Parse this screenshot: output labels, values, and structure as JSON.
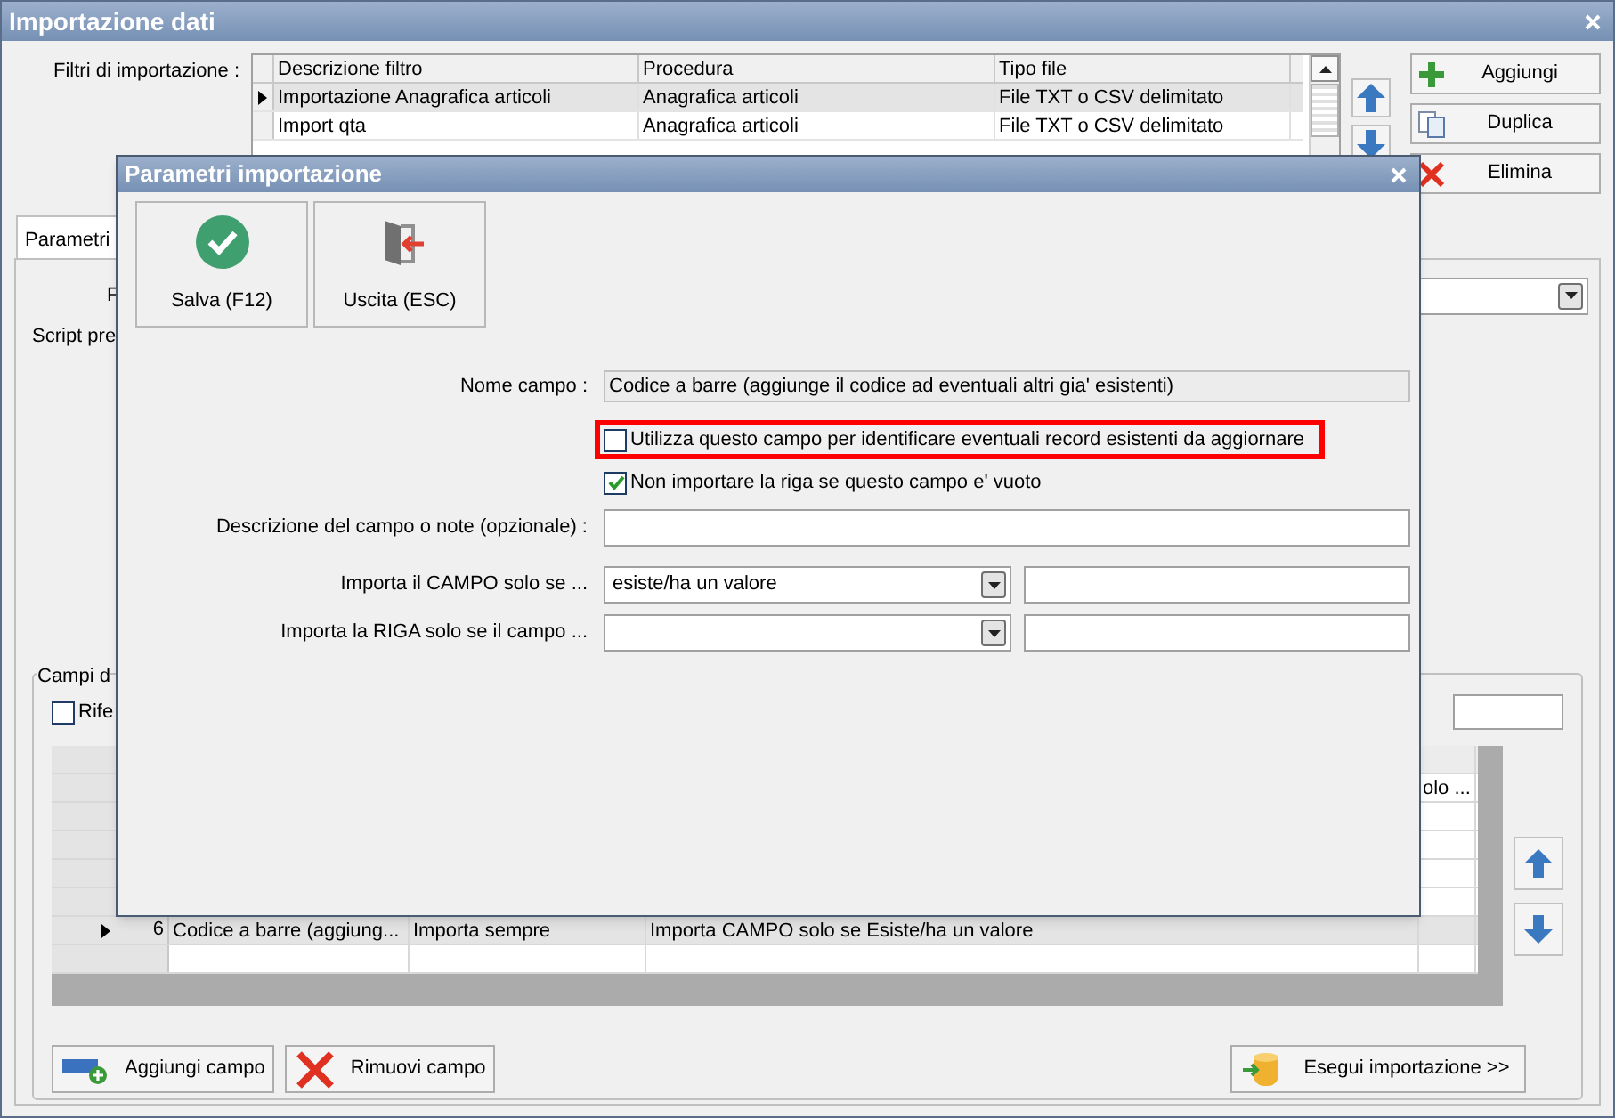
{
  "window": {
    "title": "Importazione dati"
  },
  "filters": {
    "label": "Filtri di importazione :",
    "columns": [
      "Descrizione filtro",
      "Procedura",
      "Tipo file"
    ],
    "rows": [
      {
        "selected": true,
        "cells": [
          "Importazione Anagrafica articoli",
          "Anagrafica articoli",
          "File TXT o CSV delimitato"
        ]
      },
      {
        "selected": false,
        "cells": [
          "Import qta",
          "Anagrafica articoli",
          "File TXT o CSV delimitato"
        ]
      }
    ]
  },
  "side_buttons": [
    {
      "kind": "add",
      "label": "Aggiungi"
    },
    {
      "kind": "duplicate",
      "label": "Duplica"
    },
    {
      "kind": "delete",
      "label": "Elimina"
    }
  ],
  "tab": {
    "label": "Parametri",
    "selected": true
  },
  "panel_labels": [
    "F",
    "Script pre"
  ],
  "fields_group": {
    "label": "Campi d",
    "checkbox": {
      "label": "Rife",
      "checked": false
    },
    "grid": {
      "rows": [
        {
          "selected": false,
          "column_4": "olo ..."
        },
        {
          "selected": true,
          "number": "6",
          "column_1": "Codice a barre (aggiung...",
          "column_2": "Importa sempre",
          "column_3": "Importa CAMPO solo se Esiste/ha un valore"
        }
      ]
    }
  },
  "bottom_buttons": [
    {
      "kind": "add",
      "label": "Aggiungi campo"
    },
    {
      "kind": "remove",
      "label": "Rimuovi campo"
    },
    {
      "kind": "run",
      "label": "Esegui importazione >>"
    }
  ],
  "dialog": {
    "title": "Parametri importazione",
    "toolbar": [
      {
        "kind": "save",
        "label": "Salva (F12)"
      },
      {
        "kind": "exit",
        "label": "Uscita (ESC)"
      }
    ],
    "name_field": {
      "label": "Nome campo :",
      "value": "Codice a barre (aggiunge il codice ad eventuali altri gia' esistenti)"
    },
    "checkboxes": [
      {
        "label": "Utilizza questo campo per identificare eventuali record esistenti da aggiornare",
        "checked": false,
        "highlighted": true
      },
      {
        "label": "Non importare la riga se questo campo e' vuoto",
        "checked": true,
        "highlighted": false
      }
    ],
    "description": {
      "label": "Descrizione del campo o note (opzionale) :"
    },
    "conditions": [
      {
        "label": "Importa il CAMPO solo se ...",
        "value": "esiste/ha un valore"
      },
      {
        "label": "Importa la RIGA solo se il campo ..."
      }
    ]
  }
}
